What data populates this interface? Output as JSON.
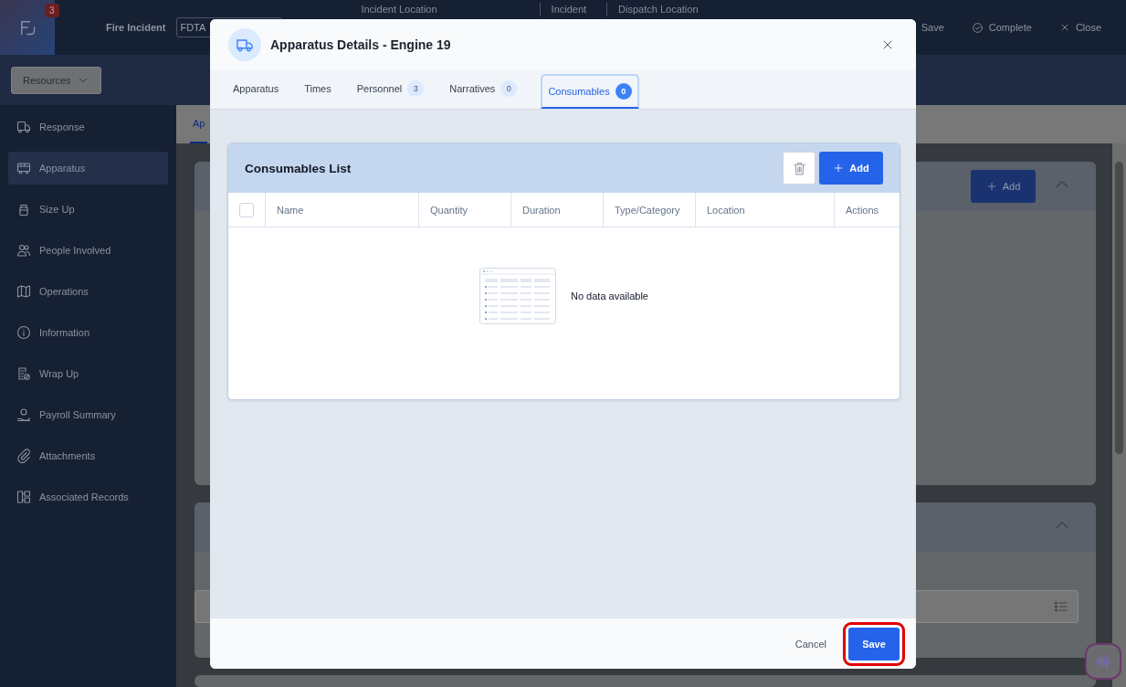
{
  "header": {
    "notification_count": "3",
    "incident_type": "Fire Incident",
    "incident_number": "FDTA",
    "labels": [
      "Incident Location",
      "Incident",
      "Dispatch Location"
    ],
    "actions": [
      {
        "label": "Save",
        "kind": "plain"
      },
      {
        "label": "Complete",
        "kind": "check"
      },
      {
        "label": "Close",
        "kind": "close"
      }
    ]
  },
  "toolbar": {
    "menu": "Resources"
  },
  "sidebar": {
    "items": [
      {
        "label": "Response",
        "kind": "response",
        "selected": false
      },
      {
        "label": "Apparatus",
        "kind": "apparatus",
        "selected": true
      },
      {
        "label": "Size Up",
        "kind": "sizeup",
        "selected": false
      },
      {
        "label": "People Involved",
        "kind": "people",
        "selected": false
      },
      {
        "label": "Operations",
        "kind": "map",
        "selected": false
      },
      {
        "label": "Information",
        "kind": "info",
        "selected": false
      },
      {
        "label": "Wrap Up",
        "kind": "wrapup",
        "selected": false
      },
      {
        "label": "Payroll Summary",
        "kind": "payroll",
        "selected": false
      },
      {
        "label": "Attachments",
        "kind": "attachment",
        "selected": false
      },
      {
        "label": "Associated Records",
        "kind": "records",
        "selected": false
      }
    ]
  },
  "page": {
    "tabs": [
      {
        "label": "Ap",
        "selected": true
      }
    ],
    "add_button": "Add"
  },
  "modal": {
    "title": "Apparatus Details - Engine 19",
    "tabs": [
      {
        "label": "Apparatus",
        "selected": false
      },
      {
        "label": "Times",
        "selected": false
      },
      {
        "label": "Personnel",
        "count": "3",
        "selected": false
      },
      {
        "label": "Narratives",
        "count": "0",
        "selected": false
      },
      {
        "label": "Consumables",
        "count": "0",
        "selected": true
      }
    ],
    "list": {
      "title": "Consumables List",
      "add_button": "Add",
      "select_all_checked": false,
      "columns": [
        "Name",
        "Quantity",
        "Duration",
        "Type/Category",
        "Location",
        "Actions"
      ],
      "empty_message": "No data available"
    },
    "footer": {
      "buttons": [
        {
          "label": "Cancel",
          "kind": "text",
          "highlighted": false
        },
        {
          "label": "Save",
          "kind": "primary",
          "highlighted": true
        }
      ]
    }
  }
}
